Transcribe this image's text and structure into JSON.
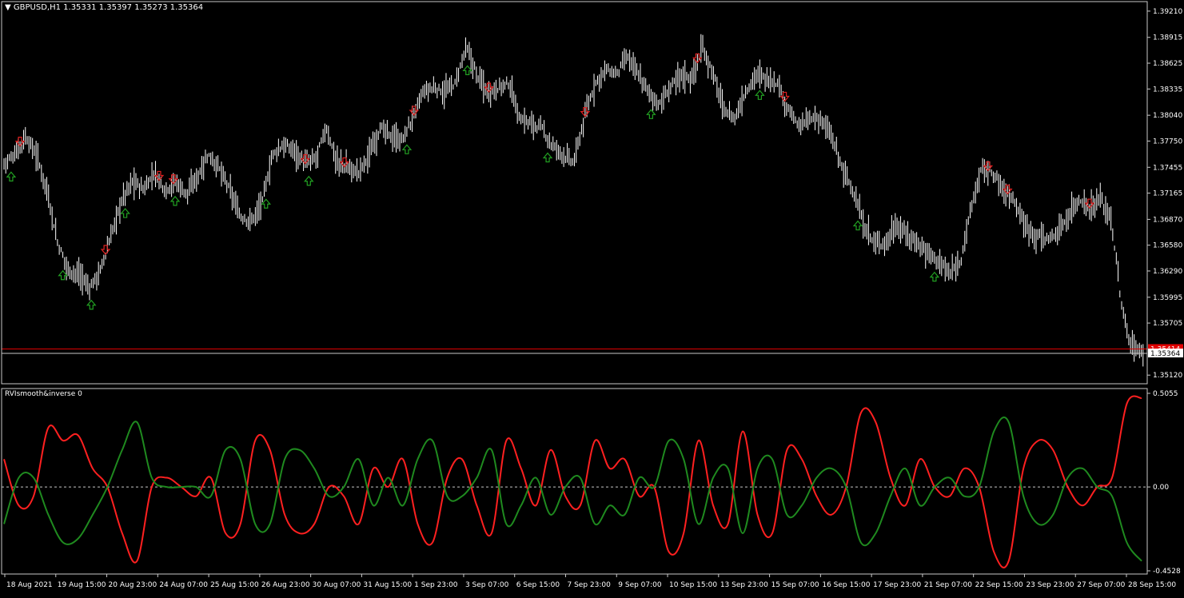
{
  "header": {
    "symbol": "GBPUSD,H1",
    "ohlc": "1.35331 1.35397 1.35273 1.35364"
  },
  "indicator": {
    "label": "RVIsmooth&inverse 0"
  },
  "colors": {
    "background": "#000000",
    "bars": "#ffffff",
    "up_arrow": "#22a022",
    "down_arrow": "#e02020",
    "rvi_red": "#ff2020",
    "rvi_green": "#1f8a1f",
    "bid_line": "#e00000",
    "ask_line": "#c8c8c8"
  },
  "chart_data": [
    {
      "type": "ohlc",
      "panel": "price",
      "price_axis_ticks": [
        "1.39210",
        "1.38915",
        "1.38625",
        "1.38335",
        "1.38040",
        "1.37750",
        "1.37455",
        "1.37165",
        "1.36870",
        "1.36580",
        "1.36290",
        "1.35995",
        "1.35705",
        "1.35120"
      ],
      "ylim": [
        1.3505,
        1.3929
      ],
      "current_price": "1.35364",
      "bid_marker": "1.35414",
      "time_ticks": [
        "18 Aug 2021",
        "19 Aug 15:00",
        "20 Aug 23:00",
        "24 Aug 07:00",
        "25 Aug 15:00",
        "26 Aug 23:00",
        "30 Aug 07:00",
        "31 Aug 15:00",
        "1 Sep 23:00",
        "3 Sep 07:00",
        "6 Sep 15:00",
        "7 Sep 23:00",
        "9 Sep 07:00",
        "10 Sep 15:00",
        "13 Sep 23:00",
        "15 Sep 07:00",
        "16 Sep 15:00",
        "17 Sep 23:00",
        "21 Sep 07:00",
        "22 Sep 15:00",
        "23 Sep 23:00",
        "27 Sep 07:00",
        "28 Sep 15:00"
      ],
      "close_path": [
        [
          0,
          1.375
        ],
        [
          2,
          1.376
        ],
        [
          4,
          1.378
        ],
        [
          6,
          1.376
        ],
        [
          8,
          1.372
        ],
        [
          10,
          1.366
        ],
        [
          12,
          1.363
        ],
        [
          14,
          1.3625
        ],
        [
          16,
          1.361
        ],
        [
          18,
          1.363
        ],
        [
          20,
          1.367
        ],
        [
          22,
          1.371
        ],
        [
          24,
          1.373
        ],
        [
          26,
          1.372
        ],
        [
          28,
          1.374
        ],
        [
          30,
          1.372
        ],
        [
          32,
          1.373
        ],
        [
          34,
          1.3715
        ],
        [
          36,
          1.3735
        ],
        [
          38,
          1.376
        ],
        [
          40,
          1.3745
        ],
        [
          42,
          1.372
        ],
        [
          44,
          1.369
        ],
        [
          46,
          1.3685
        ],
        [
          48,
          1.3705
        ],
        [
          50,
          1.376
        ],
        [
          52,
          1.377
        ],
        [
          54,
          1.3765
        ],
        [
          56,
          1.375
        ],
        [
          58,
          1.3755
        ],
        [
          60,
          1.379
        ],
        [
          62,
          1.375
        ],
        [
          64,
          1.3745
        ],
        [
          66,
          1.374
        ],
        [
          68,
          1.376
        ],
        [
          70,
          1.379
        ],
        [
          72,
          1.378
        ],
        [
          74,
          1.3775
        ],
        [
          76,
          1.38
        ],
        [
          78,
          1.383
        ],
        [
          80,
          1.3835
        ],
        [
          82,
          1.383
        ],
        [
          84,
          1.384
        ],
        [
          86,
          1.388
        ],
        [
          88,
          1.385
        ],
        [
          90,
          1.383
        ],
        [
          92,
          1.3835
        ],
        [
          94,
          1.384
        ],
        [
          96,
          1.38
        ],
        [
          98,
          1.3795
        ],
        [
          100,
          1.379
        ],
        [
          102,
          1.377
        ],
        [
          104,
          1.376
        ],
        [
          106,
          1.375
        ],
        [
          108,
          1.38
        ],
        [
          110,
          1.384
        ],
        [
          112,
          1.3855
        ],
        [
          114,
          1.385
        ],
        [
          116,
          1.387
        ],
        [
          118,
          1.385
        ],
        [
          120,
          1.383
        ],
        [
          122,
          1.3815
        ],
        [
          124,
          1.3835
        ],
        [
          126,
          1.385
        ],
        [
          128,
          1.3845
        ],
        [
          130,
          1.388
        ],
        [
          132,
          1.385
        ],
        [
          134,
          1.381
        ],
        [
          136,
          1.38
        ],
        [
          138,
          1.383
        ],
        [
          140,
          1.385
        ],
        [
          142,
          1.3845
        ],
        [
          144,
          1.384
        ],
        [
          146,
          1.381
        ],
        [
          148,
          1.379
        ],
        [
          150,
          1.38
        ],
        [
          152,
          1.38
        ],
        [
          154,
          1.378
        ],
        [
          156,
          1.3745
        ],
        [
          158,
          1.372
        ],
        [
          160,
          1.368
        ],
        [
          162,
          1.366
        ],
        [
          164,
          1.366
        ],
        [
          166,
          1.368
        ],
        [
          168,
          1.367
        ],
        [
          170,
          1.366
        ],
        [
          172,
          1.365
        ],
        [
          174,
          1.364
        ],
        [
          176,
          1.3625
        ],
        [
          178,
          1.364
        ],
        [
          180,
          1.37
        ],
        [
          182,
          1.3745
        ],
        [
          184,
          1.374
        ],
        [
          186,
          1.372
        ],
        [
          188,
          1.371
        ],
        [
          190,
          1.368
        ],
        [
          192,
          1.367
        ],
        [
          194,
          1.3665
        ],
        [
          196,
          1.367
        ],
        [
          198,
          1.369
        ],
        [
          200,
          1.371
        ],
        [
          202,
          1.37
        ],
        [
          204,
          1.371
        ],
        [
          206,
          1.369
        ],
        [
          207,
          1.364
        ],
        [
          208,
          1.359
        ],
        [
          209,
          1.356
        ],
        [
          210,
          1.3545
        ],
        [
          212,
          1.3536
        ]
      ],
      "markers_up": [
        4,
        33,
        49,
        68,
        96,
        147,
        171,
        226,
        260,
        305,
        363,
        424,
        479,
        522
      ],
      "markers_down": [
        9,
        57,
        87,
        95,
        169,
        191,
        230,
        272,
        326,
        389,
        438,
        552,
        563,
        609
      ]
    },
    {
      "type": "line",
      "panel": "indicator",
      "title": "RVIsmooth&inverse 0",
      "axis_ticks": [
        "0.5055",
        "0.00",
        "-0.4528"
      ],
      "ylim": [
        -0.4528,
        0.5055
      ],
      "series": [
        {
          "color": "rvi_red",
          "values": [
            0.15,
            -0.1,
            -0.05,
            0.32,
            0.25,
            0.28,
            0.1,
            0.0,
            -0.25,
            -0.4,
            0.0,
            0.05,
            0.0,
            -0.05,
            0.05,
            -0.25,
            -0.2,
            0.25,
            0.2,
            -0.15,
            -0.25,
            -0.2,
            0.0,
            -0.05,
            -0.2,
            0.1,
            0.0,
            0.15,
            -0.2,
            -0.3,
            0.05,
            0.15,
            -0.1,
            -0.25,
            0.25,
            0.1,
            -0.1,
            0.2,
            -0.05,
            -0.1,
            0.25,
            0.1,
            0.15,
            -0.05,
            0.0,
            -0.35,
            -0.25,
            0.25,
            -0.1,
            -0.2,
            0.3,
            -0.15,
            -0.25,
            0.2,
            0.15,
            -0.05,
            -0.15,
            0.0,
            0.4,
            0.35,
            0.05,
            -0.1,
            0.15,
            0.0,
            -0.05,
            0.1,
            0.0,
            -0.35,
            -0.4,
            0.1,
            0.25,
            0.2,
            0.0,
            -0.1,
            0.0,
            0.05,
            0.45,
            0.48
          ]
        },
        {
          "color": "rvi_green",
          "values": [
            -0.2,
            0.05,
            0.05,
            -0.15,
            -0.3,
            -0.28,
            -0.15,
            0.0,
            0.2,
            0.35,
            0.05,
            0.0,
            0.0,
            0.0,
            -0.05,
            0.2,
            0.15,
            -0.2,
            -0.2,
            0.15,
            0.2,
            0.1,
            -0.05,
            0.0,
            0.15,
            -0.1,
            0.05,
            -0.1,
            0.15,
            0.25,
            -0.05,
            -0.05,
            0.05,
            0.2,
            -0.2,
            -0.1,
            0.05,
            -0.15,
            0.0,
            0.05,
            -0.2,
            -0.1,
            -0.15,
            0.05,
            0.0,
            0.25,
            0.15,
            -0.2,
            0.05,
            0.1,
            -0.25,
            0.1,
            0.15,
            -0.15,
            -0.1,
            0.05,
            0.1,
            0.0,
            -0.3,
            -0.25,
            -0.05,
            0.1,
            -0.1,
            0.0,
            0.05,
            -0.05,
            0.0,
            0.3,
            0.35,
            -0.05,
            -0.2,
            -0.15,
            0.05,
            0.1,
            0.0,
            -0.05,
            -0.3,
            -0.4
          ]
        }
      ]
    }
  ]
}
